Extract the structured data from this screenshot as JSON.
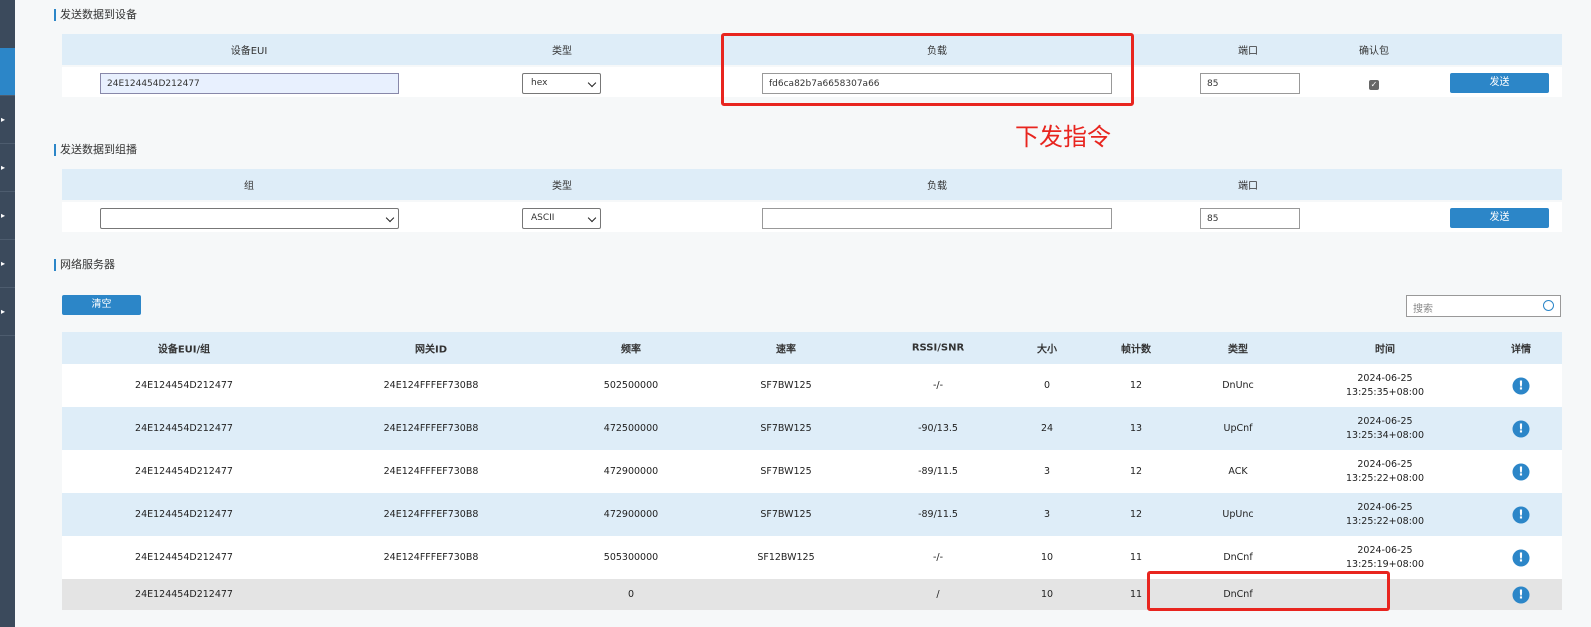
{
  "send_device": {
    "title": "发送数据到设备",
    "headers": [
      "设备EUI",
      "类型",
      "负载",
      "端口",
      "确认包"
    ],
    "eui_value": "24E124454D212477",
    "type_value": "hex",
    "payload_value": "fd6ca82b7a6658307a66",
    "port_value": "85",
    "confirm_checked": true,
    "send_label": "发送"
  },
  "annotation": {
    "text": "下发指令",
    "color": "#e8251f"
  },
  "send_group": {
    "title": "发送数据到组播",
    "headers": [
      "组",
      "类型",
      "负载",
      "端口"
    ],
    "group_value": "",
    "type_value": "ASCII",
    "payload_value": "",
    "port_value": "85",
    "send_label": "发送"
  },
  "network_server": {
    "title": "网络服务器",
    "clear_label": "清空",
    "search_placeholder": "搜索",
    "columns": [
      "设备EUI/组",
      "网关ID",
      "频率",
      "速率",
      "RSSI/SNR",
      "大小",
      "帧计数",
      "类型",
      "时间",
      "详情"
    ],
    "rows": [
      {
        "eui": "24E124454D212477",
        "gw": "24E124FFFEF730B8",
        "freq": "502500000",
        "rate": "SF7BW125",
        "rssi": "-/-",
        "size": "0",
        "fcnt": "12",
        "type": "DnUnc",
        "date": "2024-06-25",
        "time": "13:25:35+08:00"
      },
      {
        "eui": "24E124454D212477",
        "gw": "24E124FFFEF730B8",
        "freq": "472500000",
        "rate": "SF7BW125",
        "rssi": "-90/13.5",
        "size": "24",
        "fcnt": "13",
        "type": "UpCnf",
        "date": "2024-06-25",
        "time": "13:25:34+08:00"
      },
      {
        "eui": "24E124454D212477",
        "gw": "24E124FFFEF730B8",
        "freq": "472900000",
        "rate": "SF7BW125",
        "rssi": "-89/11.5",
        "size": "3",
        "fcnt": "12",
        "type": "ACK",
        "date": "2024-06-25",
        "time": "13:25:22+08:00"
      },
      {
        "eui": "24E124454D212477",
        "gw": "24E124FFFEF730B8",
        "freq": "472900000",
        "rate": "SF7BW125",
        "rssi": "-89/11.5",
        "size": "3",
        "fcnt": "12",
        "type": "UpUnc",
        "date": "2024-06-25",
        "time": "13:25:22+08:00"
      },
      {
        "eui": "24E124454D212477",
        "gw": "24E124FFFEF730B8",
        "freq": "505300000",
        "rate": "SF12BW125",
        "rssi": "-/-",
        "size": "10",
        "fcnt": "11",
        "type": "DnCnf",
        "date": "2024-06-25",
        "time": "13:25:19+08:00"
      },
      {
        "eui": "24E124454D212477",
        "gw": "",
        "freq": "0",
        "rate": "",
        "rssi": "/",
        "size": "10",
        "fcnt": "11",
        "type": "DnCnf",
        "date": "",
        "time": ""
      }
    ]
  }
}
